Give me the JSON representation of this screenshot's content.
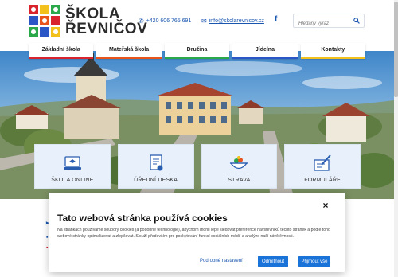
{
  "header": {
    "logo_line1": "ŠKOLA",
    "logo_line2": "ŘEVNIČOV",
    "phone": "+420 606 765 691",
    "email": "info@skolarevnicov.cz",
    "facebook_glyph": "f",
    "search_placeholder": "Hledaný výraz"
  },
  "nav": {
    "items": [
      {
        "label": "Základní škola",
        "color": "#d9232d"
      },
      {
        "label": "Mateřská škola",
        "color": "#e9541d"
      },
      {
        "label": "Družina",
        "color": "#2aa84a"
      },
      {
        "label": "Jídelna",
        "color": "#2a56c6"
      },
      {
        "label": "Kontakty",
        "color": "#f3c11b"
      }
    ]
  },
  "cards": [
    {
      "label": "ŠKOLA ONLINE",
      "icon": "laptop-icon"
    },
    {
      "label": "ÚŘEDNÍ DESKA",
      "icon": "document-stamp-icon"
    },
    {
      "label": "STRAVA",
      "icon": "food-bowl-icon"
    },
    {
      "label": "FORMULÁŘE",
      "icon": "form-pen-icon"
    }
  ],
  "cookie": {
    "title": "Tato webová stránka používá cookies",
    "text": "Na stránkách používáme soubory cookies (a podobné technologie), abychom mohli lépe sledovat preference návštěvníků těchto stránek a podle toho webové stránky optimalizovat a zlepšovat. Slouží především pro poskytování funkcí sociálních médií a analýze naší návštěvnosti.",
    "settings_label": "Podrobné nastavení",
    "reject_label": "Odmítnout",
    "accept_label": "Přijmout vše",
    "close_glyph": "×"
  },
  "colors": {
    "accent": "#1a73d9",
    "link": "#1a56b0",
    "card_bg": "#e8f1fb"
  }
}
